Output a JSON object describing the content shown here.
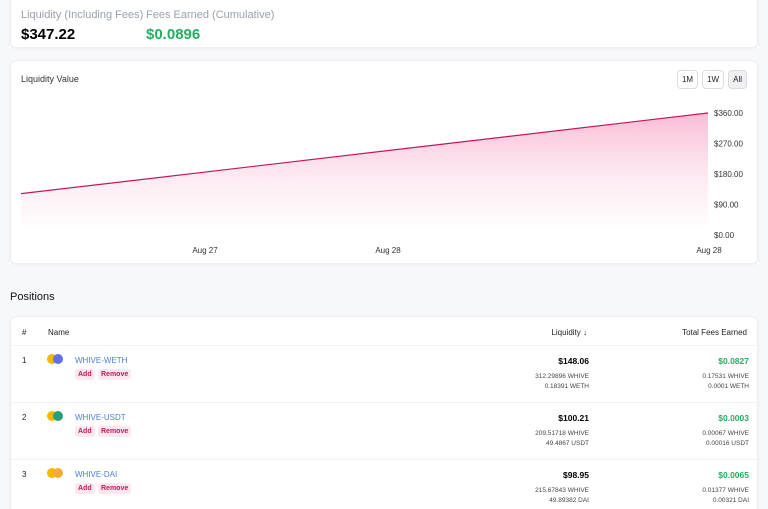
{
  "stats": {
    "liquidity_label": "Liquidity (Including Fees)",
    "liquidity_value": "$347.22",
    "fees_label": "Fees Earned (Cumulative)",
    "fees_value": "$0.0896",
    "fees_color": "#27ae60"
  },
  "chart": {
    "title": "Liquidity Value",
    "ranges": [
      "1M",
      "1W",
      "All"
    ],
    "active_range": "All"
  },
  "chart_data": {
    "type": "area",
    "title": "Liquidity Value",
    "x": [
      "start",
      "end"
    ],
    "values": [
      122,
      360
    ],
    "y_ticks": [
      "$360.00",
      "$270.00",
      "$180.00",
      "$90.00",
      "$0.00"
    ],
    "x_ticks": [
      "Aug 27",
      "Aug 28",
      "Aug 28"
    ],
    "ylim": [
      0,
      360
    ],
    "line_color": "#c2185b",
    "fill_color": "#f8bbd0",
    "grid": false,
    "legend": "none"
  },
  "positions": {
    "section_title": "Positions",
    "headers": {
      "index": "#",
      "name": "Name",
      "liquidity": "Liquidity ↓",
      "fees": "Total Fees Earned"
    },
    "add_label": "Add",
    "remove_label": "Remove",
    "rows": [
      {
        "index": "1",
        "name": "WHIVE-WETH",
        "token_color": "#6270e8",
        "liquidity": "$148.06",
        "liq_sub1": "312.29896 WHIVE",
        "liq_sub2": "0.18391 WETH",
        "fees": "$0.0827",
        "fee_sub1": "0.17531 WHIVE",
        "fee_sub2": "0.0001 WETH"
      },
      {
        "index": "2",
        "name": "WHIVE-USDT",
        "token_color": "#26a17b",
        "liquidity": "$100.21",
        "liq_sub1": "209.51718 WHIVE",
        "liq_sub2": "49.4867 USDT",
        "fees": "$0.0003",
        "fee_sub1": "0.00067 WHIVE",
        "fee_sub2": "0.00016 USDT"
      },
      {
        "index": "3",
        "name": "WHIVE-DAI",
        "token_color": "#f5ac37",
        "liquidity": "$98.95",
        "liq_sub1": "215.67843 WHIVE",
        "liq_sub2": "49.89382 DAI",
        "fees": "$0.0065",
        "fee_sub1": "0.01377 WHIVE",
        "fee_sub2": "0.00321 DAI"
      }
    ]
  }
}
